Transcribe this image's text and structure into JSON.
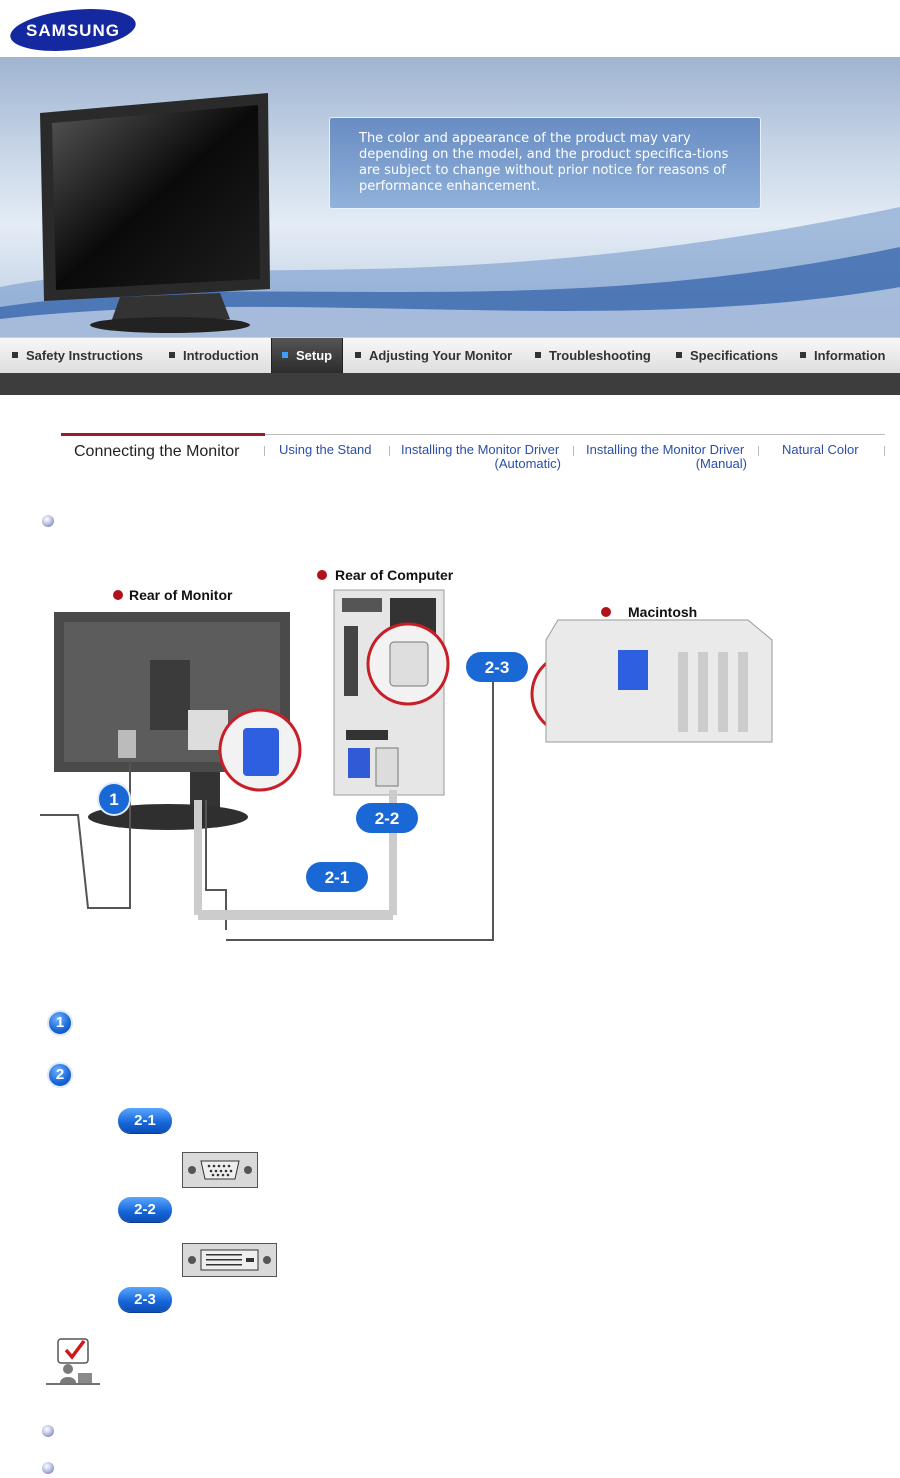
{
  "brand": {
    "logo_text": "SAMSUNG",
    "color": "#1428a0"
  },
  "banner": {
    "notice": "The color and appearance of the product may vary depending on the model, and the product specifica-tions are subject to change without prior notice for reasons of performance enhancement."
  },
  "nav": {
    "items": [
      {
        "label": "Safety Instructions"
      },
      {
        "label": "Introduction"
      },
      {
        "label": "Setup",
        "active": true
      },
      {
        "label": "Adjusting Your Monitor"
      },
      {
        "label": "Troubleshooting"
      },
      {
        "label": "Specifications"
      },
      {
        "label": "Information"
      }
    ]
  },
  "subnav": {
    "items": [
      {
        "label": "Connecting the Monitor",
        "active": true
      },
      {
        "label": "Using the Stand"
      },
      {
        "label": "Installing the Monitor Driver",
        "label2": "(Automatic)"
      },
      {
        "label": "Installing the Monitor Driver",
        "label2": "(Manual)"
      },
      {
        "label": "Natural Color"
      }
    ]
  },
  "diagram": {
    "rear_monitor": "Rear of Monitor",
    "rear_computer": "Rear of Computer",
    "macintosh": "Macintosh",
    "badges": {
      "one": "1",
      "two_one": "2-1",
      "two_two": "2-2",
      "two_three": "2-3"
    }
  },
  "steps": {
    "step1": "1",
    "step2": "2",
    "sub": [
      "2-1",
      "2-2",
      "2-3"
    ]
  },
  "colors": {
    "accent_blue": "#1565d8",
    "active_red": "#9b1b2a",
    "link_blue": "#2a4fa8",
    "nav_dark": "#3d3d3d"
  },
  "icons": [
    "bullet-icon",
    "vga-connector-icon",
    "dvi-connector-icon",
    "note-check-icon"
  ]
}
